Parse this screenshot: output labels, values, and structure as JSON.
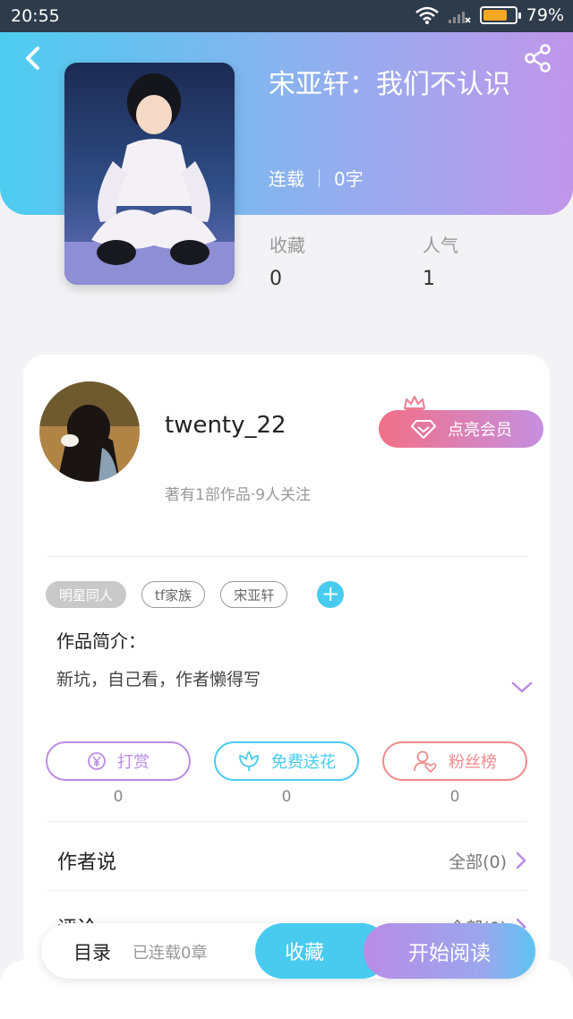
{
  "status_bar": {
    "time": "20:55",
    "battery": "79%",
    "battery_level": 0.79
  },
  "book": {
    "title": "宋亚轩：我们不认识",
    "status": "连载",
    "word_count": "0字",
    "stats": [
      {
        "label": "收藏",
        "value": "0"
      },
      {
        "label": "人气",
        "value": "1"
      }
    ]
  },
  "author": {
    "name": "twenty_22",
    "desc": "著有1部作品·9人关注",
    "vip_label": "点亮会员"
  },
  "tags": [
    "明星同人",
    "tf家族",
    "宋亚轩"
  ],
  "intro": {
    "title": "作品简介：",
    "text": "新坑，自己看，作者懒得写"
  },
  "actions": [
    {
      "label": "打赏",
      "count": "0",
      "color": "#b98ce6"
    },
    {
      "label": "免费送花",
      "count": "0",
      "color": "#49cbf0"
    },
    {
      "label": "粉丝榜",
      "count": "0",
      "color": "#f08a8a"
    }
  ],
  "sections": [
    {
      "title": "作者说",
      "more": "全部(0)"
    },
    {
      "title": "评论",
      "more": "全部(0)"
    }
  ],
  "bottom_bar": {
    "toc": "目录",
    "chapters": "已连载0章",
    "collect": "收藏",
    "read": "开始阅读"
  },
  "colors": {
    "accent_blue": "#49cbf0",
    "accent_purple": "#b98ce6",
    "accent_pink": "#f27086"
  }
}
